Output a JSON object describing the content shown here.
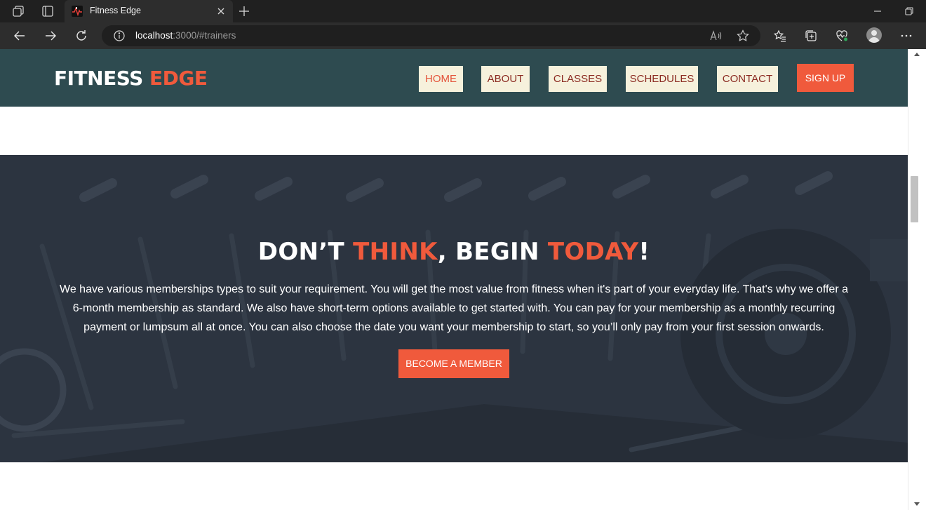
{
  "browser": {
    "tab_title": "Fitness Edge",
    "url_host": "localhost",
    "url_rest": ":3000/#trainers"
  },
  "site": {
    "logo_main": "FITNESS ",
    "logo_accent": "EDGE",
    "nav": [
      {
        "label": "HOME",
        "active": true
      },
      {
        "label": "ABOUT",
        "active": false
      },
      {
        "label": "CLASSES",
        "active": false
      },
      {
        "label": "SCHEDULES",
        "active": false
      },
      {
        "label": "CONTACT",
        "active": false
      }
    ],
    "signup_label": "SIGN UP"
  },
  "hero": {
    "heading_part1": "DON’T ",
    "heading_part2": "THINK",
    "heading_part3": ", BEGIN ",
    "heading_part4": "TODAY",
    "heading_part5": "!",
    "body": "We have various memberships types to suit your requirement. You will get the most value from fitness when it's part of your everyday life. That's why we offer a 6-month membership as standard. We also have short-term options available to get started with. You can pay for your membership as a monthly recurring payment or lumpsum all at once. You can also choose the date you want your membership to start, so you’ll only pay from your first session onwards.",
    "cta_label": "BECOME A MEMBER"
  },
  "colors": {
    "header_bg": "#2e4b50",
    "accent": "#f05a3c",
    "nav_button_bg": "#f6f1dc",
    "nav_text": "#8c2b22",
    "hero_overlay": "#2c3440"
  },
  "icons": [
    "workspaces-icon",
    "tab-actions-icon",
    "close-icon",
    "new-tab-icon",
    "minimize-icon",
    "restore-icon",
    "back-icon",
    "forward-icon",
    "refresh-icon",
    "site-info-icon",
    "read-aloud-icon",
    "favorite-star-icon",
    "favorites-list-icon",
    "collections-icon",
    "health-icon",
    "profile-avatar",
    "more-menu-icon"
  ]
}
